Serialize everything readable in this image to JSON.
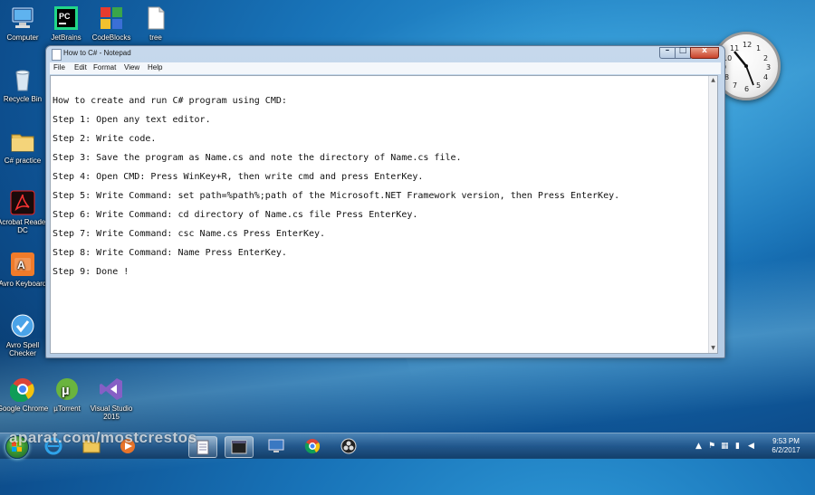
{
  "desktop": {
    "icons": [
      {
        "label": "Computer"
      },
      {
        "label": "JetBrains"
      },
      {
        "label": "CodeBlocks"
      },
      {
        "label": "tree"
      },
      {
        "label": "Recycle Bin"
      },
      {
        "label": "C# practice"
      },
      {
        "label": "Acrobat Reader DC"
      },
      {
        "label": "Avro Keyboard"
      },
      {
        "label": "Avro Spell Checker"
      },
      {
        "label": "Google Chrome"
      },
      {
        "label": "µTorrent"
      },
      {
        "label": "Visual Studio 2015"
      }
    ]
  },
  "clock_gadget": {
    "numbers": [
      "12",
      "1",
      "2",
      "3",
      "4",
      "5",
      "6",
      "7",
      "8",
      "9",
      "10",
      "11"
    ]
  },
  "notepad": {
    "title": "How to C# - Notepad",
    "menu": [
      "File",
      "Edit",
      "Format",
      "View",
      "Help"
    ],
    "lines": [
      "How to create and run C# program using CMD:",
      "Step 1: Open any text editor.",
      "Step 2: Write code.",
      "Step 3: Save the program as Name.cs and note the directory of Name.cs file.",
      "Step 4: Open CMD: Press WinKey+R, then write cmd and press EnterKey.",
      "Step 5: Write Command: set path=%path%;path of the Microsoft.NET Framework version, then Press EnterKey.",
      "Step 6: Write Command: cd directory of Name.cs file Press EnterKey.",
      "Step 7: Write Command: csc Name.cs Press EnterKey.",
      "Step 8: Write Command: Name Press EnterKey.",
      "Step 9: Done !"
    ]
  },
  "taskbar": {
    "time": "9:53 PM",
    "date": "6/2/2017"
  },
  "watermark": "aparat.com/mostcrestos"
}
